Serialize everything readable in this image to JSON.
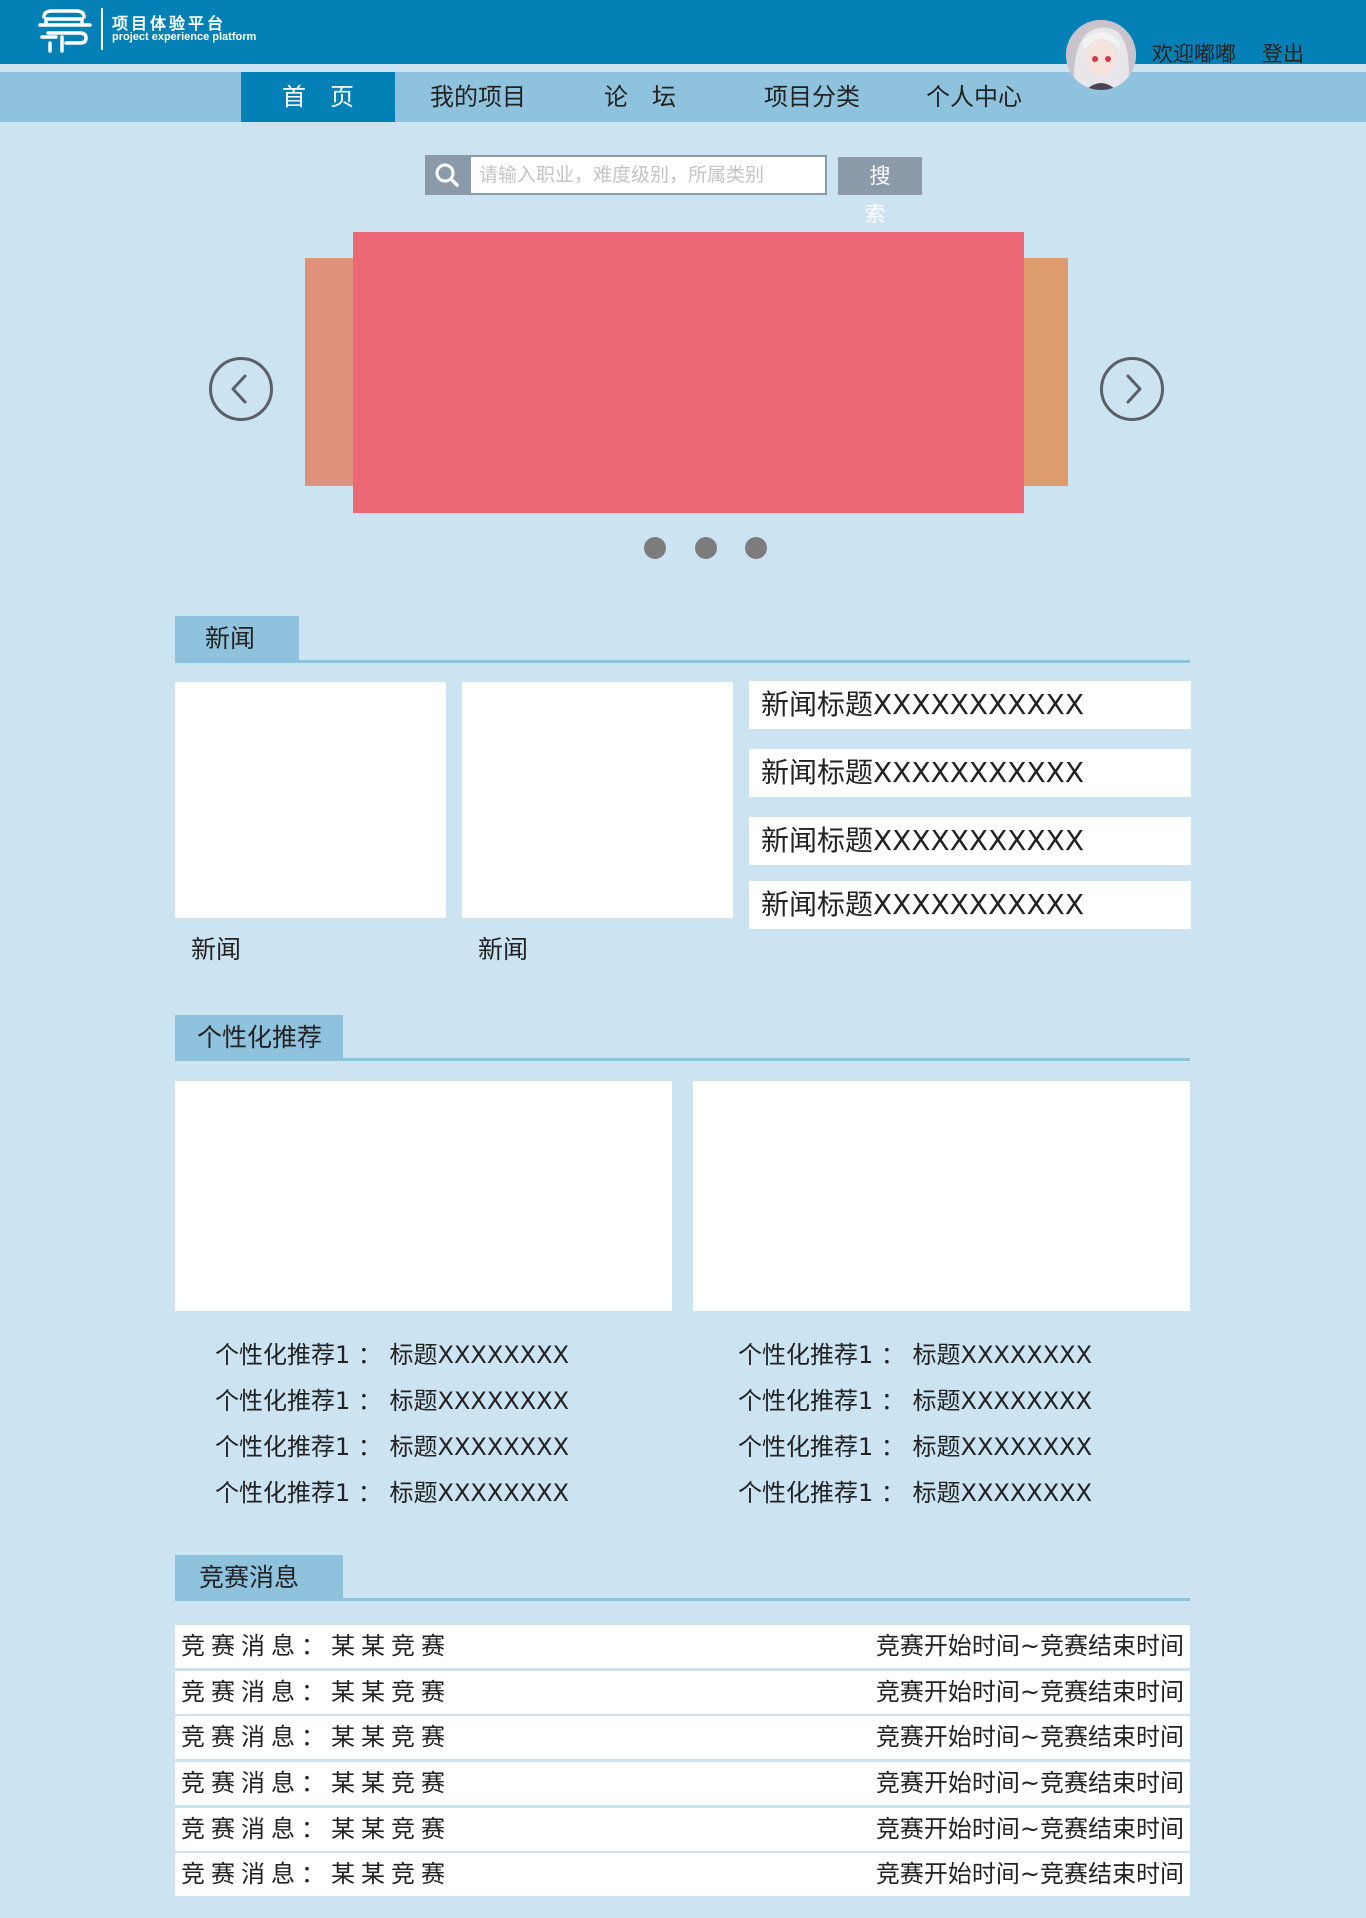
{
  "brand": {
    "title": "项目体验平台",
    "subtitle": "project experience platform"
  },
  "nav": {
    "items": [
      {
        "label": "首　页",
        "active": true
      },
      {
        "label": "我的项目",
        "active": false
      },
      {
        "label": "论　坛",
        "active": false
      },
      {
        "label": "项目分类",
        "active": false
      },
      {
        "label": "个人中心",
        "active": false
      }
    ]
  },
  "user": {
    "welcome": "欢迎嘟嘟",
    "logout": "登出"
  },
  "search": {
    "placeholder": "请输入职业，难度级别，所属类别",
    "button": "搜 索"
  },
  "carousel": {
    "slide_count": 3,
    "colors": {
      "main": "#ec6877",
      "left": "#e0937c",
      "right": "#de9c6f"
    }
  },
  "news": {
    "heading": "新闻",
    "cards": [
      {
        "caption": "新闻"
      },
      {
        "caption": "新闻"
      }
    ],
    "titles": [
      "新闻标题XXXXXXXXXXX",
      "新闻标题XXXXXXXXXXX",
      "新闻标题XXXXXXXXXXX",
      "新闻标题XXXXXXXXXXX"
    ]
  },
  "recommend": {
    "heading": "个性化推荐",
    "columns": [
      [
        "个性化推荐1 ： 标题XXXXXXXX",
        "个性化推荐1 ： 标题XXXXXXXX",
        "个性化推荐1 ： 标题XXXXXXXX",
        "个性化推荐1 ： 标题XXXXXXXX"
      ],
      [
        "个性化推荐1 ： 标题XXXXXXXX",
        "个性化推荐1 ： 标题XXXXXXXX",
        "个性化推荐1 ： 标题XXXXXXXX",
        "个性化推荐1 ： 标题XXXXXXXX"
      ]
    ]
  },
  "competition": {
    "heading": "竞赛消息",
    "rows": [
      {
        "name": "竞赛消息：某某竞赛",
        "time": "竞赛开始时间~竞赛结束时间"
      },
      {
        "name": "竞赛消息：某某竞赛",
        "time": "竞赛开始时间~竞赛结束时间"
      },
      {
        "name": "竞赛消息：某某竞赛",
        "time": "竞赛开始时间~竞赛结束时间"
      },
      {
        "name": "竞赛消息：某某竞赛",
        "time": "竞赛开始时间~竞赛结束时间"
      },
      {
        "name": "竞赛消息：某某竞赛",
        "time": "竞赛开始时间~竞赛结束时间"
      },
      {
        "name": "竞赛消息：某某竞赛",
        "time": "竞赛开始时间~竞赛结束时间"
      }
    ]
  }
}
